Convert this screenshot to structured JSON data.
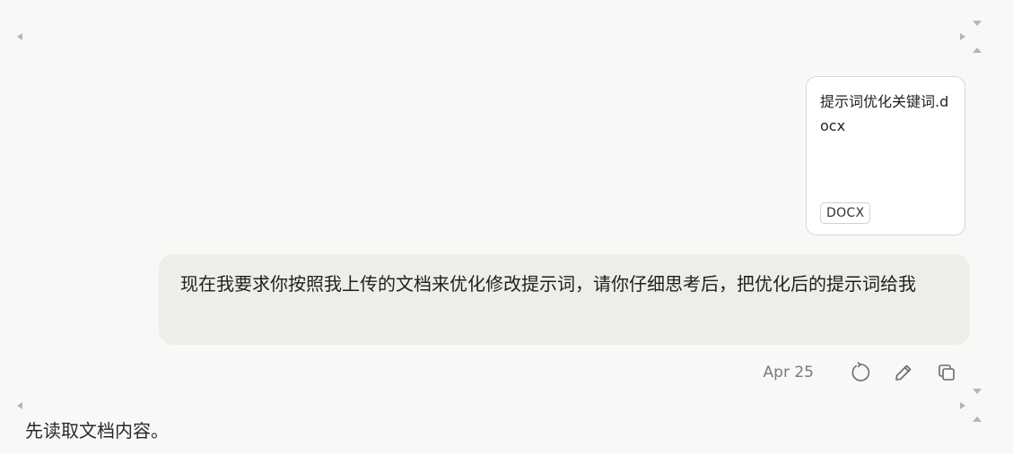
{
  "attachment": {
    "file_name": "提示词优化关键词.docx",
    "file_type": "DOCX"
  },
  "user_message": {
    "text": "现在我要求你按照我上传的文档来优化修改提示词，请你仔细思考后，把优化后的提示词给我"
  },
  "message_meta": {
    "date": "Apr 25",
    "actions": [
      "retry-icon",
      "edit-icon",
      "copy-icon"
    ]
  },
  "assistant_message": {
    "text": "先读取文档内容。"
  },
  "colors": {
    "background": "#f8f8f6",
    "bubble": "#eeedea",
    "icon": "#6b6b6b"
  }
}
